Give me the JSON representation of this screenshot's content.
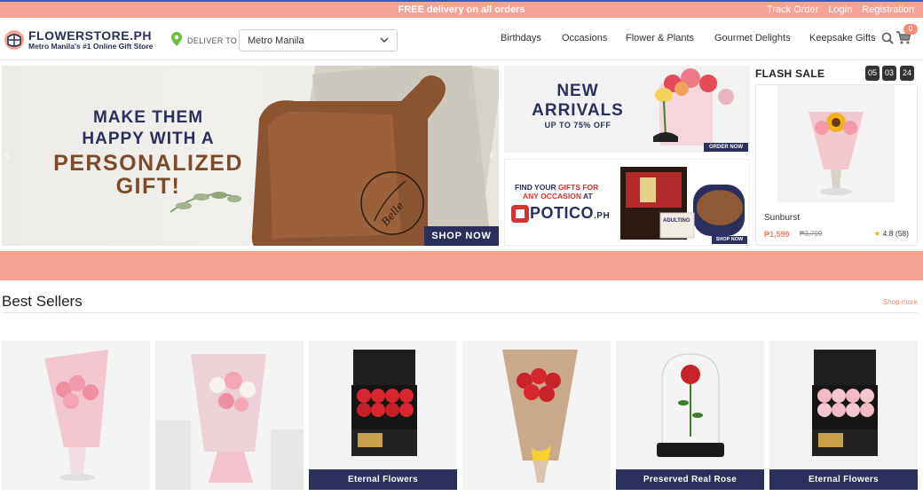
{
  "topbar": {
    "promo": "FREE delivery on all orders",
    "links": [
      "Track Order",
      "Login",
      "Registration"
    ]
  },
  "header": {
    "brand": "FLOWERSTORE.PH",
    "tagline": "Metro Manila's #1 Online Gift Store",
    "deliver_to_label": "DELIVER TO",
    "location_selected": "Metro Manila",
    "nav": [
      "Birthdays",
      "Occasions",
      "Flower & Plants",
      "Gourmet Delights",
      "Keepsake Gifts"
    ],
    "cart_count": "0"
  },
  "hero": {
    "line1": "MAKE THEM",
    "line2": "HAPPY WITH A",
    "line3": "PERSONALIZED",
    "line4": "GIFT!",
    "cta": "SHOP NOW",
    "engraving": "Belle"
  },
  "promo_new": {
    "title1": "NEW",
    "title2": "ARRIVALS",
    "subtitle": "UP TO 75% OFF",
    "cta": "ORDER NOW"
  },
  "promo_potico": {
    "line1_a": "FIND YOUR ",
    "line1_b": "GIFTS FOR",
    "line2_a": "ANY OCCASION",
    "line2_b": " AT",
    "brand": "POTICO",
    "brand_suffix": ".PH",
    "cta": "SHOP NOW",
    "box_label": "ADULTING"
  },
  "flash_sale": {
    "title": "FLASH SALE",
    "timer": [
      "05",
      "03",
      "24"
    ],
    "product": {
      "name": "Sunburst",
      "price": "₱1,599",
      "old_price": "₱3,799",
      "rating": "4.8",
      "reviews": "(58)"
    }
  },
  "best_sellers": {
    "title": "Best Sellers",
    "more": "Shop more",
    "products": [
      {
        "ribbon": ""
      },
      {
        "ribbon": ""
      },
      {
        "ribbon": "Eternal Flowers"
      },
      {
        "ribbon": ""
      },
      {
        "ribbon": "Preserved Real Rose"
      },
      {
        "ribbon": "Eternal Flowers"
      }
    ]
  },
  "colors": {
    "salmon": "#f7a394",
    "navy": "#2a2f5b",
    "brown": "#7d4a2c",
    "accent": "#f0826f"
  }
}
